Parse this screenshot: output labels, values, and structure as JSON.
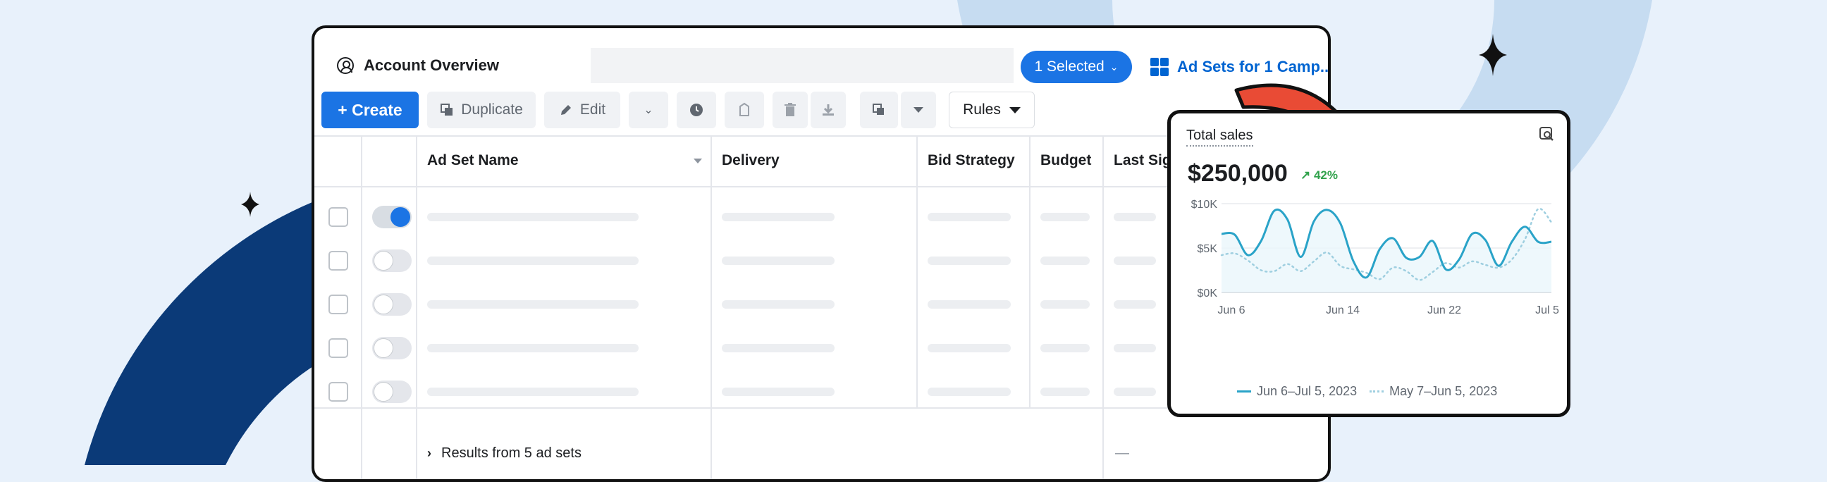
{
  "header": {
    "title": "Account Overview",
    "selected_label": "1 Selected",
    "adsets_tab_label": "Ad Sets for 1 Camp..."
  },
  "toolbar": {
    "create_label": "+ Create",
    "duplicate_label": "Duplicate",
    "edit_label": "Edit",
    "rules_label": "Rules"
  },
  "table": {
    "columns": [
      "Ad Set Name",
      "Delivery",
      "Bid Strategy",
      "Budget",
      "Last Sig"
    ],
    "rows": [
      {
        "toggle_on": true
      },
      {
        "toggle_on": false
      },
      {
        "toggle_on": false
      },
      {
        "toggle_on": false
      },
      {
        "toggle_on": false
      }
    ],
    "results_label": "Results from 5 ad sets",
    "results_dash": "—"
  },
  "card": {
    "title": "Total sales",
    "value": "$250,000",
    "delta": "↗ 42%"
  },
  "chart_data": {
    "type": "line",
    "title": "Total sales",
    "y_ticks": [
      "$10K",
      "$5K",
      "$0K"
    ],
    "ylim": [
      0,
      10000
    ],
    "x_ticks": [
      "Jun 6",
      "Jun 14",
      "Jun 22",
      "Jul 5"
    ],
    "series": [
      {
        "name": "Jun 6–Jul 5, 2023",
        "style": "solid",
        "color": "#2aa3c8",
        "values": [
          6600,
          6500,
          4200,
          5800,
          9200,
          8200,
          4000,
          8000,
          9300,
          7800,
          3500,
          1700,
          4900,
          6100,
          3900,
          4000,
          5800,
          2600,
          3700,
          6600,
          5900,
          3000,
          5700,
          7400,
          5700,
          5700
        ]
      },
      {
        "name": "May 7–Jun 5, 2023",
        "style": "dotted",
        "color": "#9fcfe0",
        "values": [
          4200,
          4400,
          3600,
          2500,
          2400,
          3200,
          2400,
          3500,
          4500,
          3000,
          2600,
          2200,
          1500,
          2800,
          2400,
          1400,
          2300,
          3300,
          2800,
          3500,
          3100,
          2800,
          3700,
          6000,
          9400,
          7900
        ]
      }
    ],
    "legend": [
      "Jun 6–Jul 5, 2023",
      "May 7–Jun 5, 2023"
    ],
    "grid": true
  },
  "colors": {
    "accent": "#1b74e4",
    "arrow": "#e94b35",
    "background": "#e8f1fb",
    "navy_arc": "#0b3a78",
    "light_arc": "#c6dcf1"
  }
}
